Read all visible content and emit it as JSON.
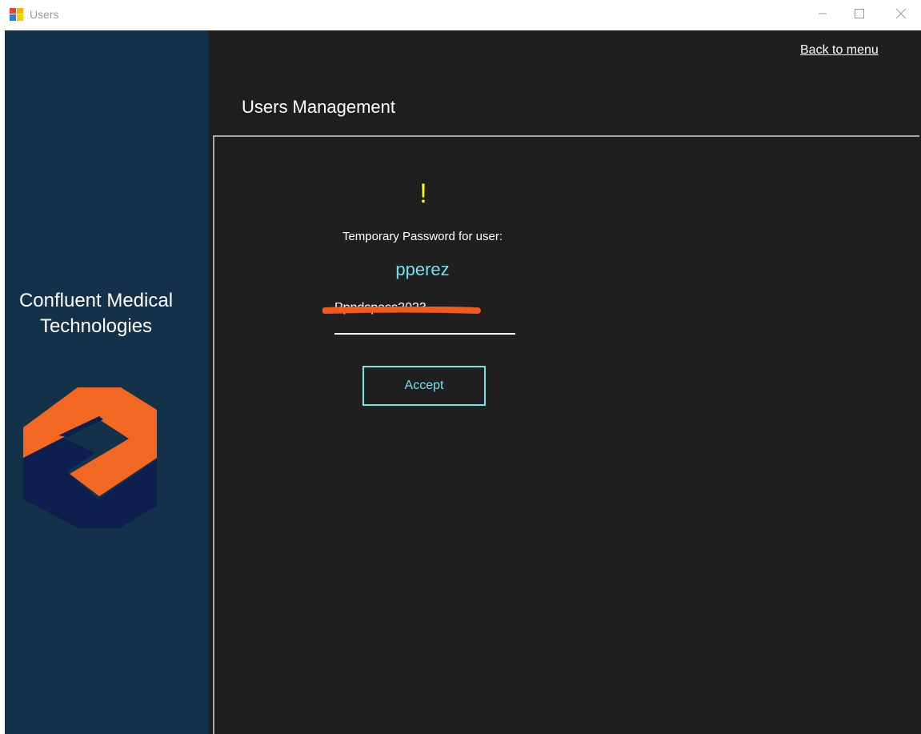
{
  "window": {
    "title": "Users",
    "icon": "app-window-icon",
    "controls": [
      "minimize-icon",
      "maximize-icon",
      "close-icon"
    ]
  },
  "sidebar": {
    "company_name": "Confluent Medical Technologies",
    "logo": "confluent-logo",
    "colors": {
      "background": "#133249",
      "logo_orange": "#f26722",
      "logo_navy": "#0d1f4e"
    }
  },
  "header": {
    "back_link": "Back to menu",
    "page_title": "Users Management"
  },
  "dialog": {
    "warning_mark": "!",
    "label": "Temporary Password for user:",
    "username": "pperez",
    "temp_password": "Ppndspass2023",
    "accept_label": "Accept",
    "colors": {
      "background": "#1f1f1f",
      "warning": "#ffff00",
      "accent": "#6fe2ef",
      "redaction": "#f25a1c"
    }
  }
}
